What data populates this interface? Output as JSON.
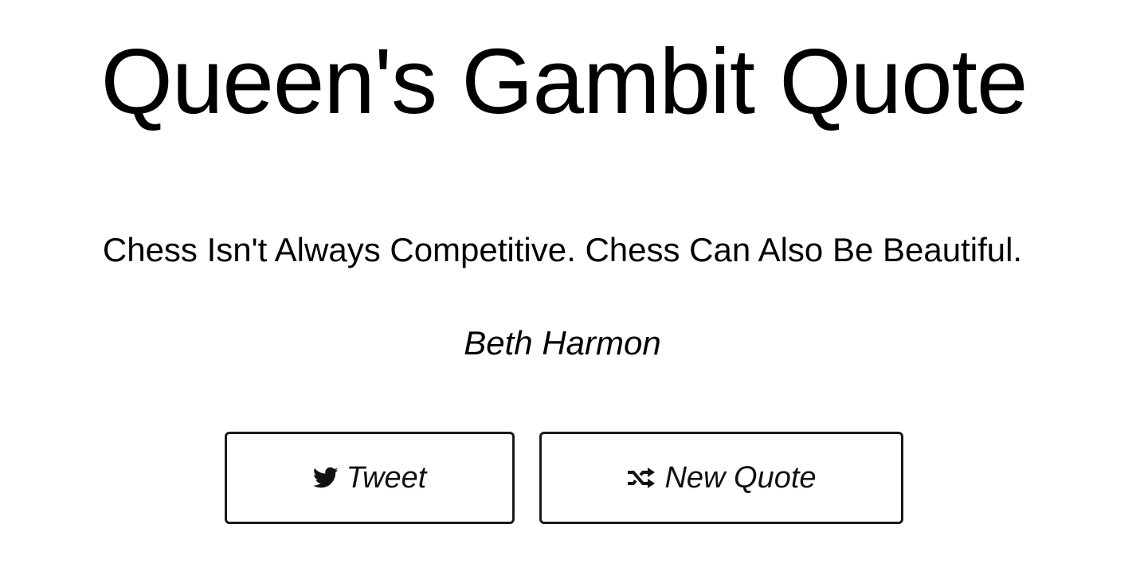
{
  "header": {
    "title": "Queen's Gambit Quote"
  },
  "quote": {
    "text": "Chess Isn't Always Competitive. Chess Can Also Be Beautiful.",
    "author": "Beth Harmon"
  },
  "actions": {
    "tweet": {
      "label": "Tweet",
      "icon": "twitter-icon"
    },
    "new_quote": {
      "label": "New Quote",
      "icon": "shuffle-icon"
    }
  },
  "colors": {
    "background": "#ffffff",
    "text": "#000000",
    "button_border": "#1a1a1a"
  }
}
